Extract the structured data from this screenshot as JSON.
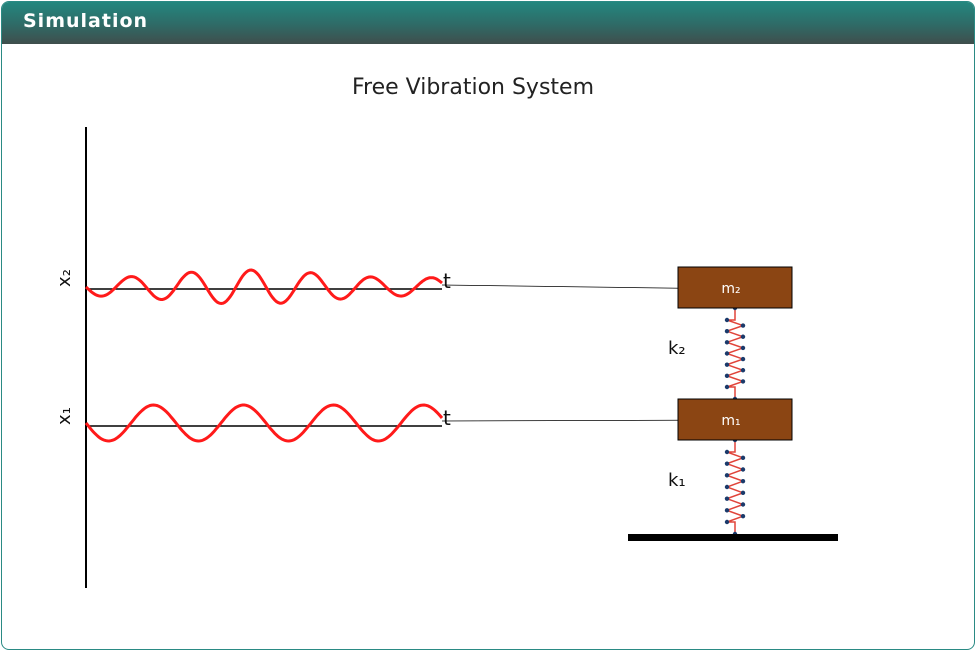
{
  "header": {
    "title": "Simulation"
  },
  "simulation": {
    "title": "Free Vibration System",
    "graph": {
      "upper_axis_label": "x₂",
      "lower_axis_label": "x₁",
      "upper_time_label": "t",
      "lower_time_label": "t"
    },
    "system": {
      "mass_upper_label": "m₂",
      "mass_lower_label": "m₁",
      "spring_upper_label": "k₂",
      "spring_lower_label": "k₁"
    },
    "colors": {
      "wave": "#ff1a1a",
      "mass_fill": "#8b4513",
      "spring": "#e0443a",
      "spring_node": "#1b3a6b",
      "ground": "#000000"
    }
  }
}
